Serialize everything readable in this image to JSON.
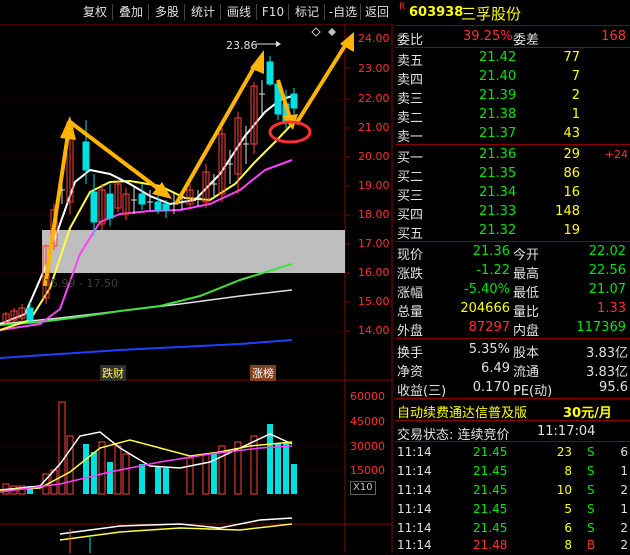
{
  "toolbar": {
    "items": [
      "复权",
      "叠加",
      "多股",
      "统计",
      "画线",
      "F10",
      "标记",
      "-自选",
      "返回"
    ]
  },
  "chart": {
    "price_labels": [
      "24.00",
      "23.00",
      "22.00",
      "21.00",
      "20.00",
      "19.00",
      "18.00",
      "17.00",
      "16.00",
      "15.00",
      "14.00"
    ],
    "high_label": "23.86",
    "low_label": "15.99 - 17.50",
    "tag_left": "跌财",
    "tag_right": "涨榜",
    "volume_labels": [
      "60000",
      "45000",
      "30000",
      "15000"
    ],
    "volume_unit": "X10"
  },
  "panel": {
    "superscript": "R",
    "code": "603938",
    "name": "三孚股份",
    "weibi_label": "委比",
    "weibi": "39.25%",
    "weicha_label": "委差",
    "weicha": "168",
    "asks": [
      {
        "label": "卖五",
        "price": "21.42",
        "vol": "77"
      },
      {
        "label": "卖四",
        "price": "21.40",
        "vol": "7"
      },
      {
        "label": "卖三",
        "price": "21.39",
        "vol": "2"
      },
      {
        "label": "卖二",
        "price": "21.38",
        "vol": "1"
      },
      {
        "label": "卖一",
        "price": "21.37",
        "vol": "43"
      }
    ],
    "bids": [
      {
        "label": "买一",
        "price": "21.36",
        "vol": "29",
        "chg": "+24"
      },
      {
        "label": "买二",
        "price": "21.35",
        "vol": "86",
        "chg": ""
      },
      {
        "label": "买三",
        "price": "21.34",
        "vol": "16",
        "chg": ""
      },
      {
        "label": "买四",
        "price": "21.33",
        "vol": "148",
        "chg": ""
      },
      {
        "label": "买五",
        "price": "21.32",
        "vol": "19",
        "chg": ""
      }
    ],
    "stats1": [
      {
        "l1": "现价",
        "v1": "21.36",
        "l2": "今开",
        "v2": "22.02"
      },
      {
        "l1": "涨跌",
        "v1": "-1.22",
        "l2": "最高",
        "v2": "22.56"
      },
      {
        "l1": "涨幅",
        "v1": "-5.40%",
        "l2": "最低",
        "v2": "21.07"
      },
      {
        "l1": "总量",
        "v1": "204666",
        "l2": "量比",
        "v2": "1.33"
      },
      {
        "l1": "外盘",
        "v1": "87297",
        "l2": "内盘",
        "v2": "117369"
      }
    ],
    "stats2": [
      {
        "l1": "换手",
        "v1": "5.35%",
        "l2": "股本",
        "v2": "3.83亿"
      },
      {
        "l1": "净资",
        "v1": "6.49",
        "l2": "流通",
        "v2": "3.83亿"
      },
      {
        "l1": "收益(三)",
        "v1": "0.170",
        "l2": "PE(动)",
        "v2": "95.6"
      }
    ],
    "ad_text": "自动续费通达信普及版",
    "ad_price": "30元/月",
    "trade_status": "交易状态: 连续竞价",
    "trade_time": "11:17:04",
    "ticks": [
      {
        "time": "11:14",
        "price": "21.45",
        "vol": "23",
        "side": "S",
        "n": "6"
      },
      {
        "time": "11:14",
        "price": "21.45",
        "vol": "8",
        "side": "S",
        "n": "1"
      },
      {
        "time": "11:14",
        "price": "21.45",
        "vol": "10",
        "side": "S",
        "n": "2"
      },
      {
        "time": "11:14",
        "price": "21.45",
        "vol": "5",
        "side": "S",
        "n": "1"
      },
      {
        "time": "11:14",
        "price": "21.45",
        "vol": "6",
        "side": "S",
        "n": "2"
      },
      {
        "time": "11:14",
        "price": "21.48",
        "vol": "8",
        "side": "B",
        "n": "2"
      }
    ]
  }
}
